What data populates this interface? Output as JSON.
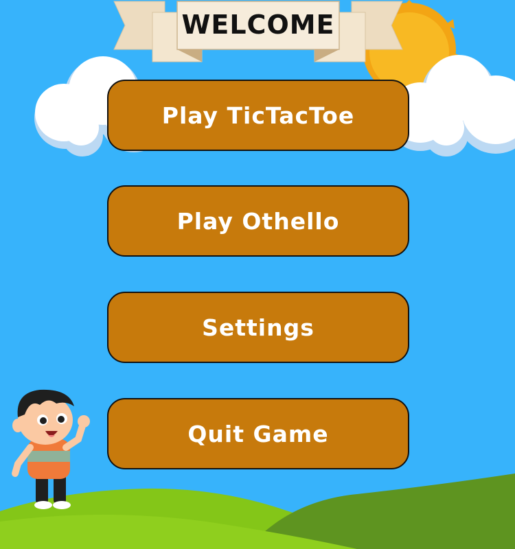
{
  "banner": {
    "title": "WELCOME"
  },
  "menu": {
    "items": [
      {
        "label": "Play TicTacToe"
      },
      {
        "label": "Play Othello"
      },
      {
        "label": "Settings"
      },
      {
        "label": "Quit Game"
      }
    ]
  },
  "colors": {
    "sky": "#37b3fb",
    "button": "#c77a0c",
    "button_text": "#ffffff",
    "hill_light": "#7fc21a",
    "hill_dark": "#5f941f",
    "sun": "#f8b21d"
  }
}
